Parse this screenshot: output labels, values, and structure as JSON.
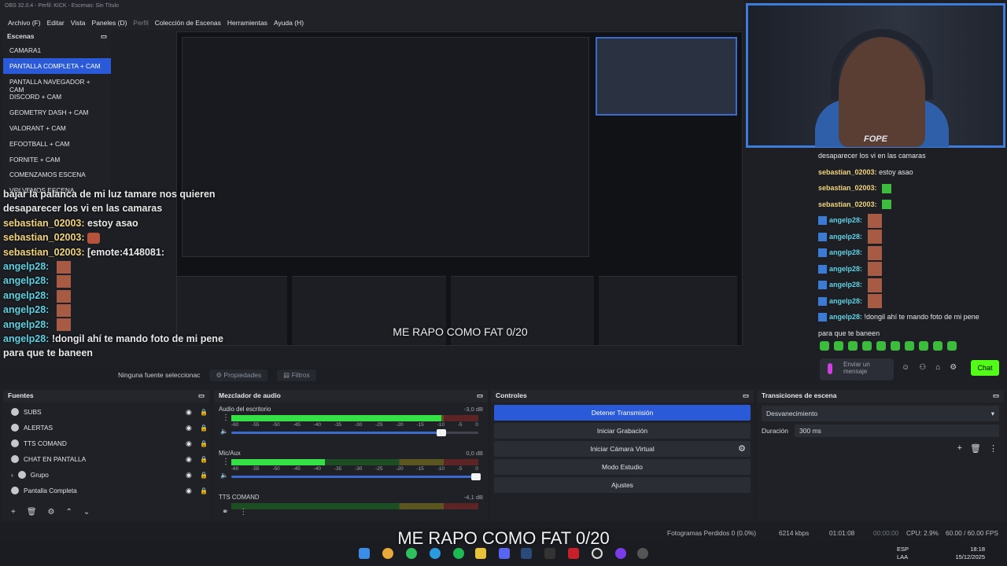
{
  "window": {
    "title": "OBS 32.0.4 - Perfil: KICK - Escenas: Sin Título"
  },
  "menu": [
    "Archivo (F)",
    "Editar",
    "Vista",
    "Paneles (D)",
    "Perfil",
    "Colección de Escenas",
    "Herramientas",
    "Ayuda (H)"
  ],
  "scenes": {
    "header": "Escenas",
    "items": [
      "CAMARA1",
      "PANTALLA COMPLETA + CAM",
      "PANTALLA NAVEGADOR + CAM",
      "DISCORD + CAM",
      "GEOMETRY DASH + CAM",
      "VALORANT + CAM",
      "EFOOTBALL + CAM",
      "FORNITE + CAM",
      "COMENZAMOS ESCENA",
      "VOLVEMOS ESCENA"
    ],
    "selected": 1
  },
  "chat_left": [
    {
      "user": "",
      "text": "bajar la palanca de mi luz tamare nos quieren"
    },
    {
      "user": "",
      "text": "desaparecer los vi en las camaras"
    },
    {
      "user": "sebastian_02003:",
      "text": "estoy asao"
    },
    {
      "user": "sebastian_02003:",
      "text": ""
    },
    {
      "user": "sebastian_02003:",
      "text": "[emote:4148081:"
    },
    {
      "user": "angelp28:",
      "text": ""
    },
    {
      "user": "angelp28:",
      "text": ""
    },
    {
      "user": "angelp28:",
      "text": ""
    },
    {
      "user": "angelp28:",
      "text": ""
    },
    {
      "user": "angelp28:",
      "text": ""
    },
    {
      "user": "angelp28:",
      "text": "!dongil ahí te mando foto de mi pene"
    },
    {
      "user": "",
      "text": "para que te baneen"
    }
  ],
  "webcam": {
    "name": "FOPE"
  },
  "chat_right": {
    "lines": [
      {
        "user": "",
        "text": "desaparecer los vi en las camaras"
      },
      {
        "user": "sebastian_02003:",
        "text": "estoy asao"
      },
      {
        "user": "sebastian_02003:",
        "text": ""
      },
      {
        "user": "sebastian_02003:",
        "text": ""
      },
      {
        "user": "angelp28:",
        "text": ""
      },
      {
        "user": "angelp28:",
        "text": ""
      },
      {
        "user": "angelp28:",
        "text": ""
      },
      {
        "user": "angelp28:",
        "text": ""
      },
      {
        "user": "angelp28:",
        "text": ""
      },
      {
        "user": "angelp28:",
        "text": ""
      },
      {
        "user": "angelp28:",
        "text": "!dongil ahí te mando foto de mi pene"
      },
      {
        "user": "",
        "text": "para que te baneen"
      }
    ],
    "input_placeholder": "Enviar un mensaje",
    "chat_button": "Chat"
  },
  "preview_overlay_text": "ME RAPO COMO FAT 0/20",
  "propbar": {
    "label": "Ninguna fuente seleccionac",
    "properties": "Propiedades",
    "filters": "Filtros"
  },
  "sources": {
    "header": "Fuentes",
    "items": [
      "SUBS",
      "ALERTAS",
      "TTS COMAND",
      "CHAT EN PANTALLA",
      "Grupo",
      "Pantalla Completa"
    ]
  },
  "mixer": {
    "header": "Mezclador de audio",
    "channels": [
      {
        "name": "Audio del escritorio",
        "db": "-3,0 dB",
        "level": 0.85,
        "volume": 0.85
      },
      {
        "name": "Mic/Aux",
        "db": "0,0 dB",
        "level": 0.38,
        "volume": 0.99
      },
      {
        "name": "TTS COMAND",
        "db": "-4,1 dB",
        "level": 0.0,
        "volume": 0.8
      }
    ],
    "scale": [
      "-60",
      "-55",
      "-50",
      "-45",
      "-40",
      "-35",
      "-30",
      "-25",
      "-20",
      "-15",
      "-10",
      "-5",
      "0"
    ]
  },
  "controls": {
    "header": "Controles",
    "buttons": [
      "Detener Transmisión",
      "Iniciar Grabación",
      "Iniciar Cámara Virtual",
      "Modo Estudio",
      "Ajustes"
    ]
  },
  "transitions": {
    "header": "Transiciones de escena",
    "selected": "Desvanecimiento",
    "duration_label": "Duración",
    "duration_value": "300 ms"
  },
  "status": {
    "dropped": "Fotogramas Perdidos 0 (0.0%)",
    "bitrate": "6214 kbps",
    "stream_time": "01:01:08",
    "rec_time": "00:00:00",
    "cpu": "CPU: 2.9%",
    "fps": "60.00 / 60.00 FPS"
  },
  "bottom_overlay_text": "ME RAPO COMO FAT 0/20",
  "taskbar": {
    "lang1": "ESP",
    "lang2": "LAA",
    "time": "18:18",
    "date": "15/12/2025"
  }
}
